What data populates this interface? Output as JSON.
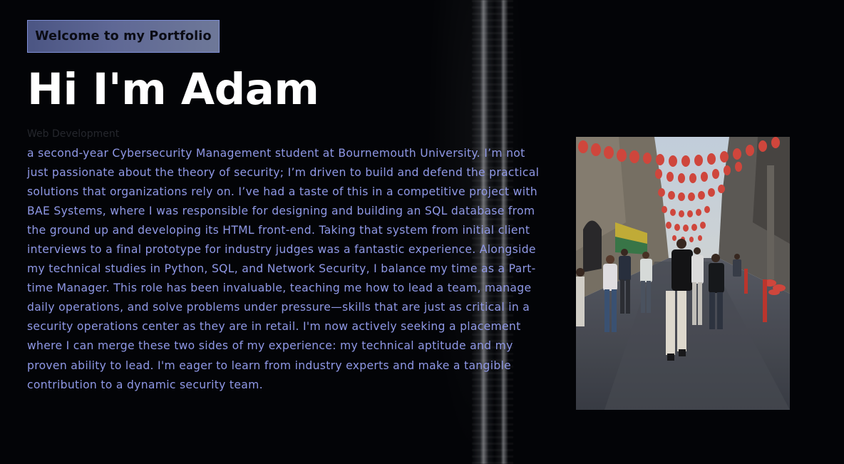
{
  "hero": {
    "badge_label": "Welcome to my Portfolio",
    "title": "Hi I'm Adam",
    "subtitle": "Web Development"
  },
  "about": {
    "bio": "a second-year Cybersecurity Management student at Bournemouth University. I’m not just passionate about the theory of security; I’m driven to build and defend the practical solutions that organizations rely on. I’ve had a taste of this in a competitive project with BAE Systems, where I was responsible for designing and building an SQL database from the ground up and developing its HTML front-end. Taking that system from initial client interviews to a final prototype for industry judges was a fantastic experience. Alongside my technical studies in Python, SQL, and Network Security, I balance my time as a Part-time Manager. This role has been invaluable, teaching me how to lead a team, manage daily operations, and solve problems under pressure—skills that are just as critical in a security operations center as they are in retail. I'm now actively seeking a placement where I can merge these two sides of my experience: my technical aptitude and my proven ability to lead. I'm eager to learn from industry experts and make a tangible contribution to a dynamic security team."
  },
  "theme": {
    "background": "#030407",
    "accent": "#8f98e6",
    "badge_border": "#7f8fd6",
    "title_color": "#ffffff"
  }
}
